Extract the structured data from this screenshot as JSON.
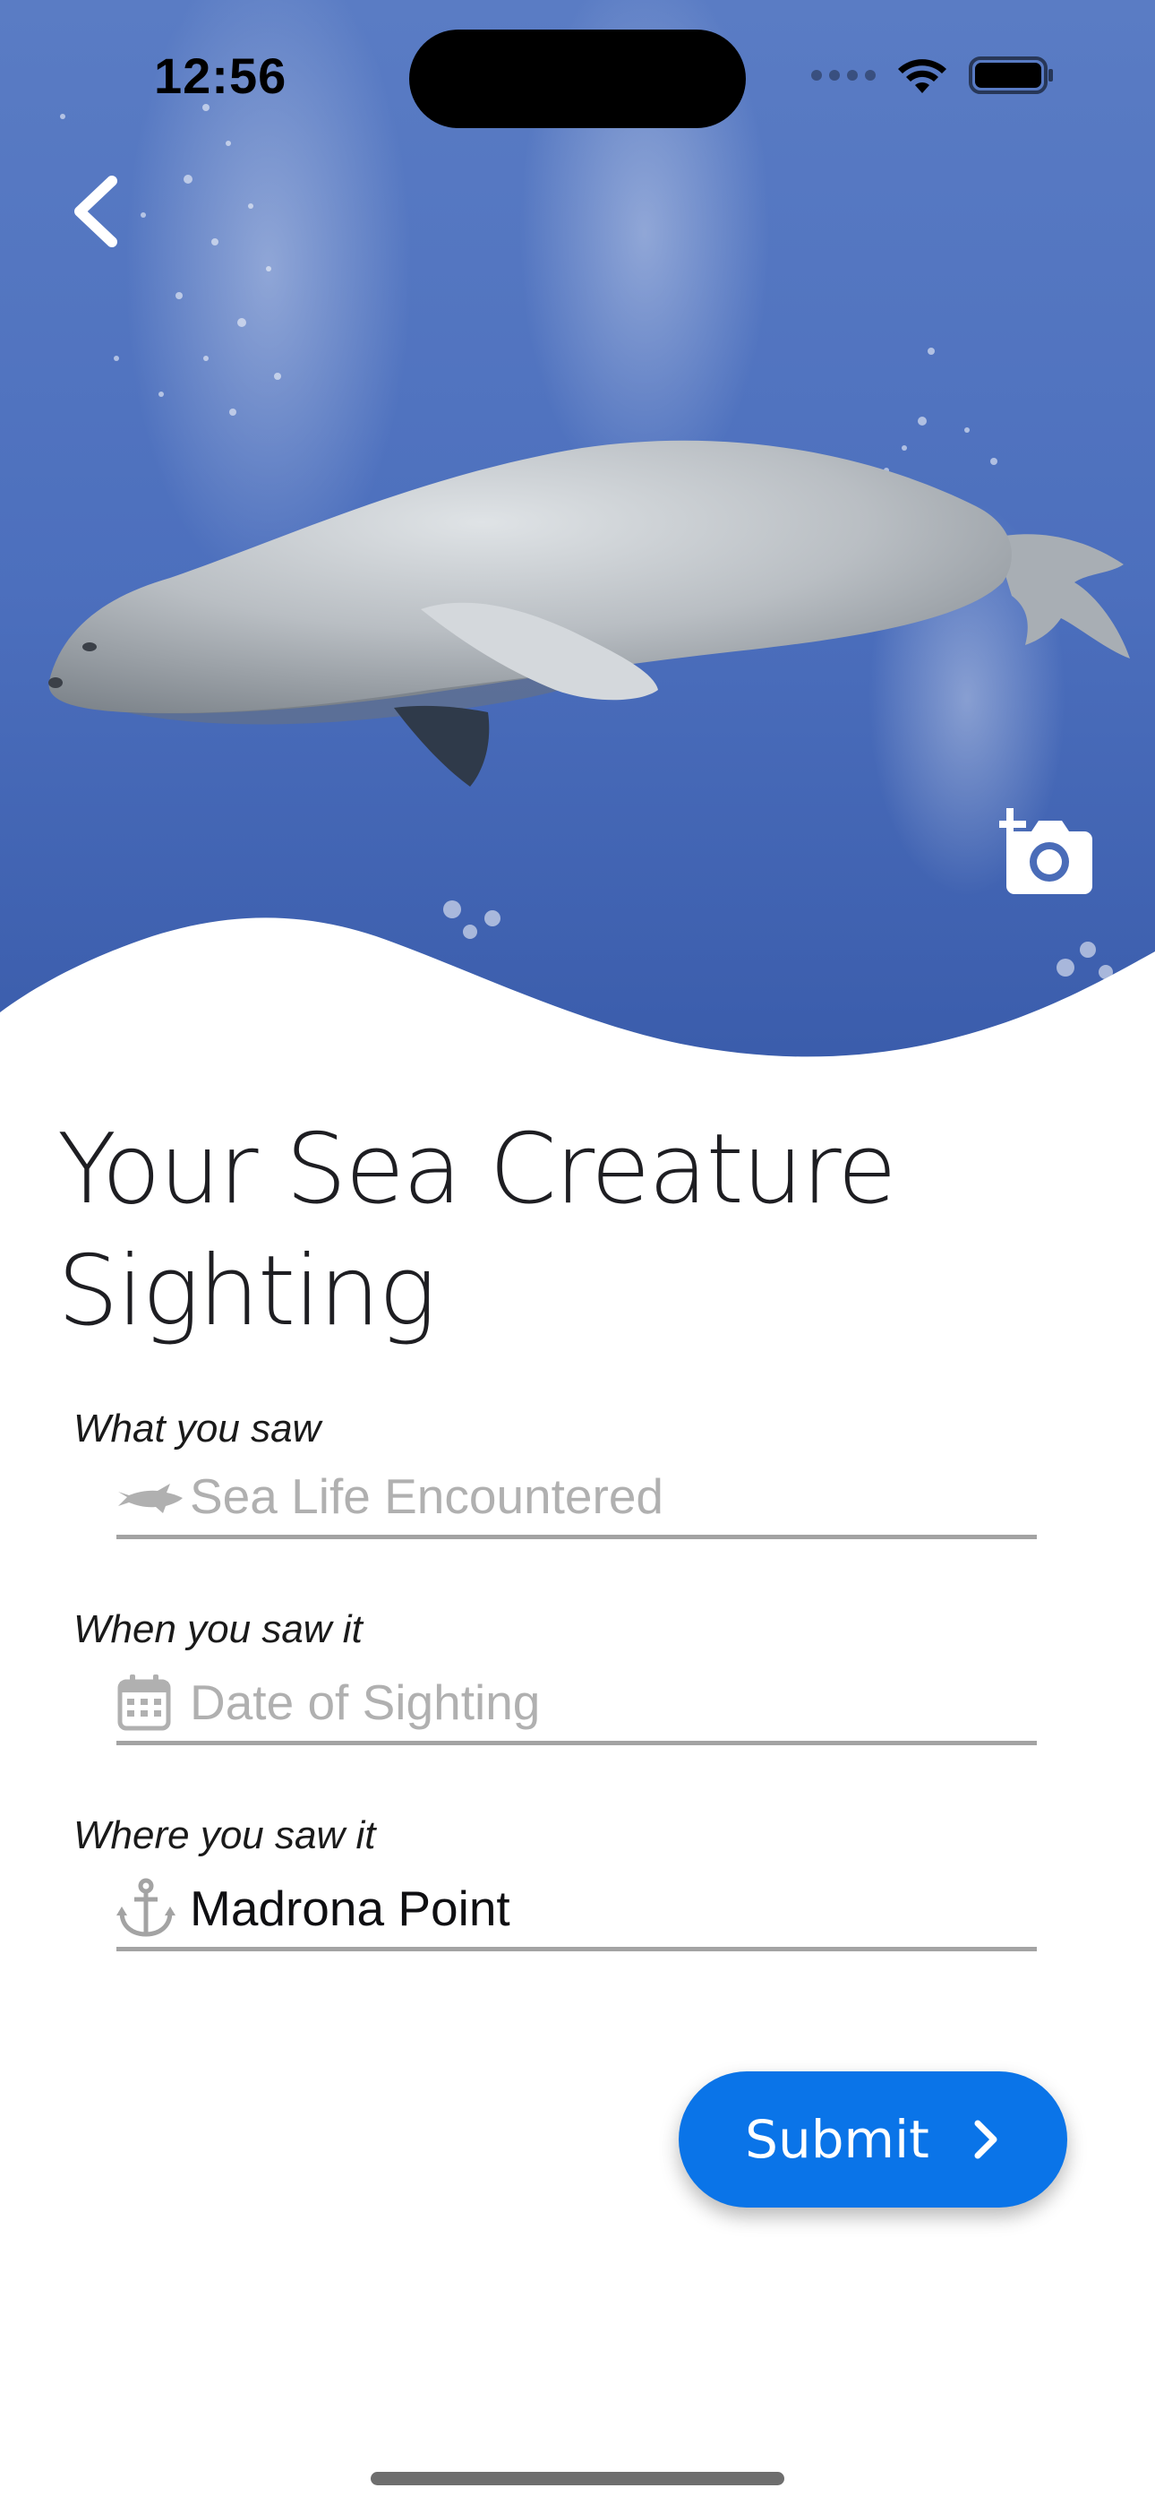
{
  "status_bar": {
    "time": "12:56"
  },
  "hero": {
    "image": "monk seal swimming underwater",
    "back_icon": "chevron-left-icon",
    "add_photo_icon": "camera-plus-icon"
  },
  "page": {
    "title": "Your Sea Creature Sighting"
  },
  "form": {
    "fields": [
      {
        "caption": "What you saw",
        "icon": "shark-icon",
        "placeholder": "Sea Life Encountered",
        "value": ""
      },
      {
        "caption": "When you saw it",
        "icon": "calendar-icon",
        "placeholder": "Date of Sighting",
        "value": ""
      },
      {
        "caption": "Where you saw it",
        "icon": "anchor-icon",
        "placeholder": "",
        "value": "Madrona Point"
      }
    ],
    "submit_label": "Submit"
  },
  "colors": {
    "accent": "#0a74e8",
    "ocean": "#4f72bf",
    "underline": "#a3a3a3",
    "placeholder": "#b0b0b0"
  }
}
